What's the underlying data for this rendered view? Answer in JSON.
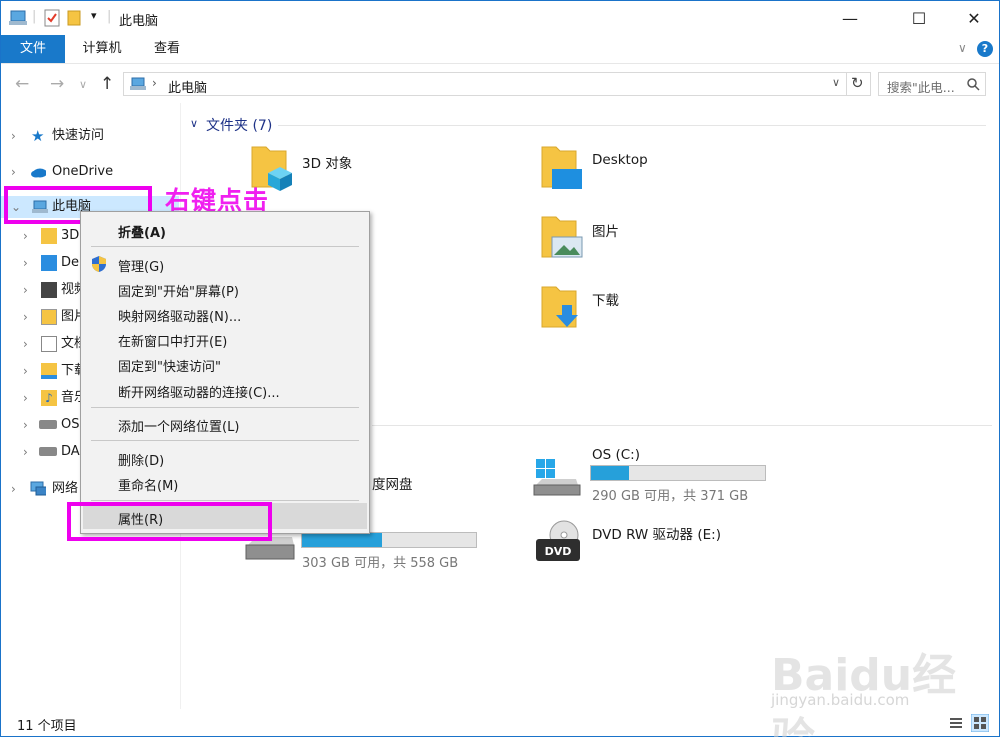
{
  "window": {
    "title": "此电脑",
    "minimize": "—",
    "maximize": "☐",
    "close": "✕"
  },
  "ribbon": {
    "tabs": [
      "文件",
      "计算机",
      "查看"
    ]
  },
  "nav": {
    "address": "此电脑",
    "search_placeholder": "搜索\"此电...",
    "back": "←",
    "forward": "→",
    "up": "↑",
    "refresh": "↻"
  },
  "sidebar": {
    "items": [
      {
        "label": "快速访问",
        "icon": "star-icon"
      },
      {
        "label": "OneDrive",
        "icon": "cloud-icon"
      },
      {
        "label": "此电脑",
        "icon": "computer-icon"
      },
      {
        "label": "3D",
        "icon": "folder-3d-icon"
      },
      {
        "label": "De",
        "icon": "desktop-folder-icon"
      },
      {
        "label": "视频",
        "icon": "video-folder-icon"
      },
      {
        "label": "图片",
        "icon": "picture-folder-icon"
      },
      {
        "label": "文档",
        "icon": "document-folder-icon"
      },
      {
        "label": "下载",
        "icon": "download-folder-icon"
      },
      {
        "label": "音乐",
        "icon": "music-folder-icon"
      },
      {
        "label": "OS",
        "icon": "drive-icon"
      },
      {
        "label": "DA",
        "icon": "drive-icon"
      },
      {
        "label": "网络",
        "icon": "network-icon"
      }
    ]
  },
  "content": {
    "folders_header": "文件夹 (7)",
    "folders": [
      {
        "label": "3D 对象",
        "icon": "folder-3d-icon"
      },
      {
        "label": "Desktop",
        "icon": "desktop-folder-icon"
      },
      {
        "label": "图片",
        "icon": "picture-folder-icon"
      },
      {
        "label": "下载",
        "icon": "download-folder-icon"
      }
    ],
    "drives": [
      {
        "label": "OS (C:)",
        "sub": "290 GB 可用，共 371 GB",
        "used_fraction": 0.22
      },
      {
        "label": "度网盘",
        "sub": "",
        "used_fraction": null
      },
      {
        "label": "",
        "sub": "303 GB 可用，共 558 GB",
        "used_fraction": 0.46
      },
      {
        "label": "DVD RW 驱动器 (E:)",
        "sub": "",
        "used_fraction": null
      }
    ]
  },
  "context_menu": {
    "items": [
      {
        "label": "折叠(A)",
        "bold": true
      },
      {
        "label": "管理(G)",
        "icon": "shield-icon"
      },
      {
        "label": "固定到\"开始\"屏幕(P)"
      },
      {
        "label": "映射网络驱动器(N)..."
      },
      {
        "label": "在新窗口中打开(E)"
      },
      {
        "label": "固定到\"快速访问\""
      },
      {
        "label": "断开网络驱动器的连接(C)..."
      },
      {
        "label": "添加一个网络位置(L)"
      },
      {
        "label": "删除(D)"
      },
      {
        "label": "重命名(M)"
      },
      {
        "label": "属性(R)"
      }
    ]
  },
  "annotation": {
    "text": "右键点击",
    "color": "#ee00ee"
  },
  "status": {
    "count": "11 个项目"
  },
  "watermark": {
    "big": "Baidu经验",
    "small": "jingyan.baidu.com"
  },
  "colors": {
    "accent": "#1979ca",
    "drive_fill": "#26a0da",
    "folder": "#f5c443"
  }
}
